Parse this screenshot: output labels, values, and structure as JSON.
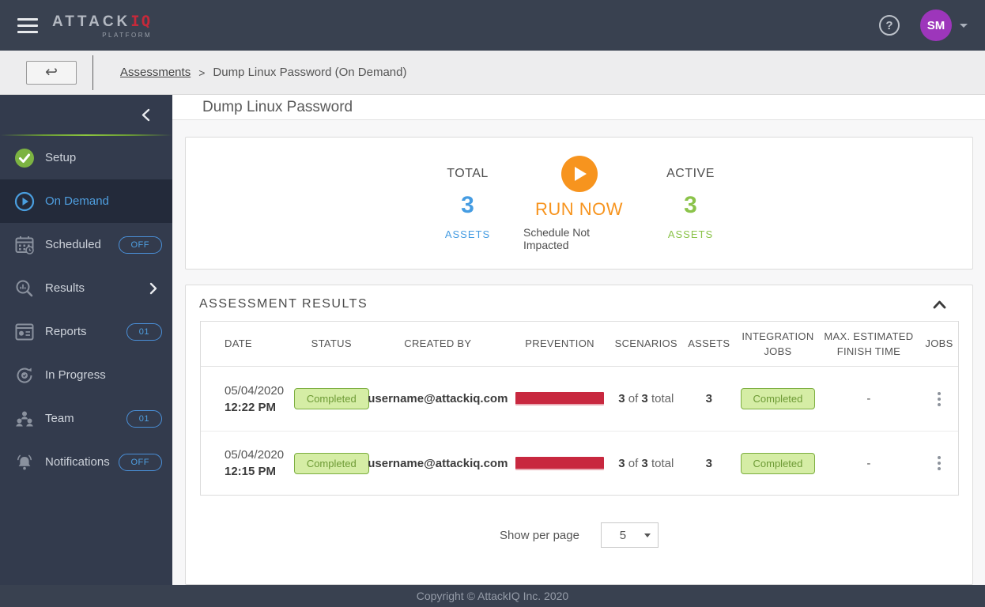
{
  "header": {
    "brand_attack": "ATTACK",
    "brand_iq": "IQ",
    "brand_platform": "PLATFORM",
    "help_glyph": "?",
    "avatar_initials": "SM"
  },
  "breadcrumb": {
    "back_glyph": "↩",
    "link": "Assessments",
    "separator": ">",
    "current": "Dump Linux Password (On Demand)"
  },
  "sidebar": {
    "items": [
      {
        "label": "Setup",
        "icon": "check-circle-icon",
        "badge": ""
      },
      {
        "label": "On Demand",
        "icon": "play-circle-icon",
        "badge": ""
      },
      {
        "label": "Scheduled",
        "icon": "calendar-icon",
        "badge": "OFF"
      },
      {
        "label": "Results",
        "icon": "magnifier-chart-icon",
        "badge": ""
      },
      {
        "label": "Reports",
        "icon": "report-icon",
        "badge": "01"
      },
      {
        "label": "In Progress",
        "icon": "sync-gear-icon",
        "badge": ""
      },
      {
        "label": "Team",
        "icon": "team-icon",
        "badge": "01"
      },
      {
        "label": "Notifications",
        "icon": "bell-icon",
        "badge": "OFF"
      }
    ]
  },
  "page": {
    "title": "Dump Linux Password"
  },
  "summary": {
    "total_label": "TOTAL",
    "total_value": "3",
    "total_unit": "ASSETS",
    "run_label": "RUN NOW",
    "run_sub": "Schedule Not Impacted",
    "active_label": "ACTIVE",
    "active_value": "3",
    "active_unit": "ASSETS"
  },
  "results": {
    "heading": "ASSESSMENT RESULTS",
    "columns": [
      "DATE",
      "STATUS",
      "CREATED BY",
      "PREVENTION",
      "SCENARIOS",
      "ASSETS",
      "INTEGRATION JOBS",
      "MAX. ESTIMATED FINISH TIME",
      "JOBS"
    ],
    "of_word": "of",
    "total_word": "total",
    "rows": [
      {
        "date": "05/04/2020",
        "time": "12:22 PM",
        "status": "Completed",
        "created_by": "username@attackiq.com",
        "scenarios_done": "3",
        "scenarios_total": "3",
        "assets": "3",
        "integration_status": "Completed",
        "max_finish": "-"
      },
      {
        "date": "05/04/2020",
        "time": "12:15 PM",
        "status": "Completed",
        "created_by": "username@attackiq.com",
        "scenarios_done": "3",
        "scenarios_total": "3",
        "assets": "3",
        "integration_status": "Completed",
        "max_finish": "-"
      }
    ],
    "pagination": {
      "label": "Show per page",
      "value": "5"
    }
  },
  "footer": {
    "copyright": "Copyright © AttackIQ Inc. 2020"
  },
  "colors": {
    "topbar": "#394150",
    "sidebar": "#333b4d",
    "sidebar_active": "#232a3a",
    "accent_blue": "#459ce2",
    "accent_green": "#8bc34a",
    "accent_orange": "#f7941e",
    "prevention_red": "#c8283f",
    "brand_red": "#c6293a",
    "avatar_purple": "#9d36bb",
    "pill_green_bg": "#d5eda5",
    "pill_green_border": "#7cae3f"
  }
}
